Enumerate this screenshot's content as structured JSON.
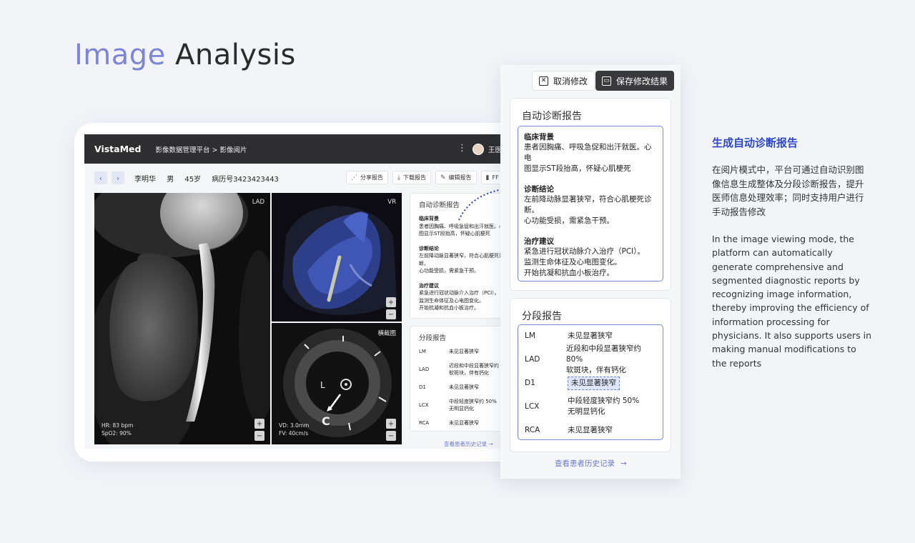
{
  "hero": {
    "word1": "Image",
    "word2": "Analysis"
  },
  "app": {
    "brand": "VistaMed",
    "breadcrumb": "影像数据管理平台 > 影像阅片",
    "user": "王医生"
  },
  "patient": {
    "name": "李明华",
    "sex": "男",
    "age": "45岁",
    "record": "病历号3423423443"
  },
  "toolbar": {
    "share": "分享报告",
    "download": "下载报告",
    "edit": "编辑报告",
    "ffr": "FF"
  },
  "images": {
    "lad": {
      "label": "LAD",
      "hr": "HR:  83 bpm",
      "spo2": "SpO2:  90%"
    },
    "vr": {
      "label": "VR"
    },
    "cross": {
      "label": "横截图",
      "vd": "VD: 3.0mm",
      "fv": "FV:  40cm/s",
      "mark_l": "L",
      "mark_c": "C"
    }
  },
  "small_report": {
    "title": "自动诊断报告",
    "bg_title": "临床背景",
    "bg_lines": [
      "患者因胸痛、呼吸急促和出汗就医。心",
      "图显示ST段抬高，怀疑心肌梗死"
    ],
    "dx_title": "诊断结论",
    "dx_lines": [
      "左前降动脉显著狭窄，符合心肌梗死诊",
      "断。",
      "心功能受损，需紧急干预。"
    ],
    "sg_title": "治疗建议",
    "sg_lines": [
      "紧急进行冠状动脉介入治疗（PCI）。",
      "监测生命体征及心电图变化。",
      "开始抗凝和抗血小板治疗。"
    ]
  },
  "small_segment": {
    "title": "分段报告",
    "rows": [
      {
        "k": "LM",
        "v": "未见显著狭窄"
      },
      {
        "k": "LAD",
        "v": "近段和中段显著狭窄约 8",
        "v2": "软斑块，伴有钙化"
      },
      {
        "k": "D1",
        "v": "未见显著狭窄"
      },
      {
        "k": "LCX",
        "v": "中段轻度狭窄约 50%",
        "v2": "无明显钙化"
      },
      {
        "k": "RCA",
        "v": "未见显著狭窄"
      }
    ],
    "history": "查看患者历史记录"
  },
  "overlay": {
    "cancel": "取消修改",
    "save": "保存修改结果",
    "report_title": "自动诊断报告",
    "bg_title": "临床背景",
    "bg_lines": [
      "患者因胸痛、呼吸急促和出汗就医。心电",
      "图显示ST段抬高，怀疑心肌梗死"
    ],
    "dx_title": "诊断结论",
    "dx_lines": [
      "左前降动脉显著狭窄，符合心肌梗死诊",
      "断。",
      "心功能受损，需紧急干预。"
    ],
    "sg_title": "治疗建议",
    "sg_lines": [
      "紧急进行冠状动脉介入治疗（PCI）。",
      "监测生命体征及心电图变化。",
      "开始抗凝和抗血小板治疗。"
    ],
    "segment_title": "分段报告",
    "segments": [
      {
        "k": "LM",
        "v": "未见显著狭窄"
      },
      {
        "k": "LAD",
        "v": "近段和中段显著狭窄约 80%",
        "v2": "软斑块，伴有钙化"
      },
      {
        "k": "D1",
        "v": "未见显著狭窄"
      },
      {
        "k": "LCX",
        "v": "中段轻度狭窄约 50%",
        "v2": "无明显钙化"
      },
      {
        "k": "RCA",
        "v": "未见显著狭窄"
      }
    ],
    "history": "查看患者历史记录"
  },
  "description": {
    "title": "生成自动诊断报告",
    "zh": "在阅片模式中，平台可通过自动识别图像信息生成整体及分段诊断报告，提升医师信息处理效率；同时支持用户进行手动报告修改",
    "en": "In the image viewing mode, the platform can automatically generate comprehensive and segmented diagnostic reports by recognizing image information, thereby improving the efficiency of information processing for physicians. It also supports users in making manual modifications to the reports"
  },
  "colors": {
    "accent": "#7d86d6",
    "link": "#6b78cf",
    "title_blue": "#2c47c9",
    "topbar": "#2e2e30"
  },
  "icons": [
    "chevron-left-icon",
    "chevron-right-icon",
    "share-icon",
    "download-icon",
    "edit-icon",
    "chart-icon",
    "zoom-in-icon",
    "zoom-out-icon",
    "close-box-icon",
    "save-icon",
    "arrow-right-icon",
    "kebab-icon"
  ]
}
